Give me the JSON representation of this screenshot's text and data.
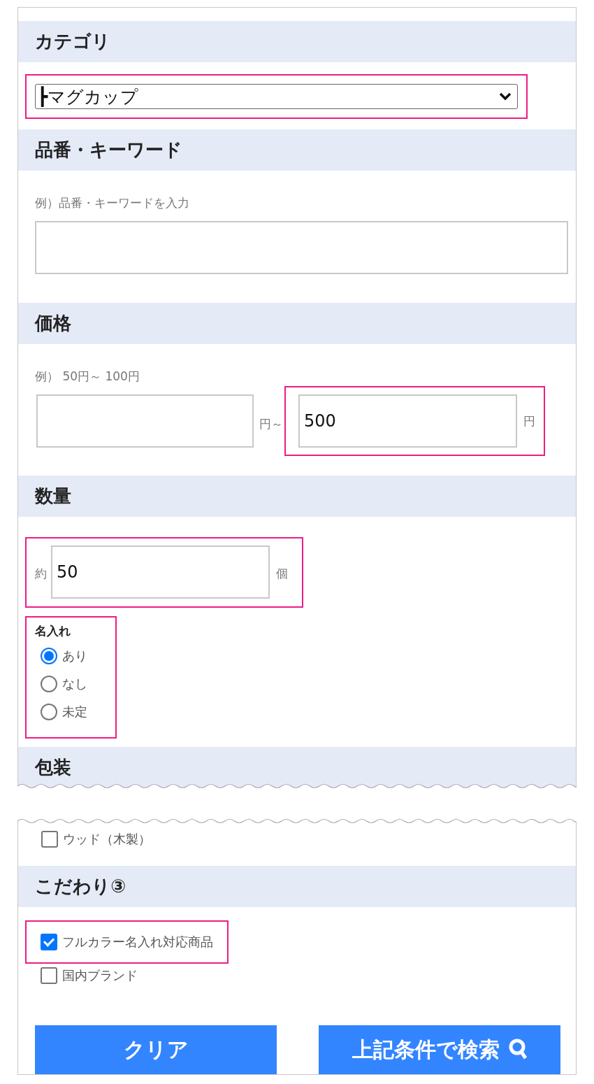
{
  "category": {
    "heading": "カテゴリ",
    "select": {
      "value": "┣マグカップ",
      "highlighted": true
    }
  },
  "keyword": {
    "heading": "品番・キーワード",
    "hint": "例）品番・キーワードを入力"
  },
  "price": {
    "heading": "価格",
    "hint": "例） 50円～ 100円",
    "min": {
      "highlighted": false
    },
    "range_sign": "円～",
    "max": {
      "value": "500",
      "unit": "円",
      "highlighted": true
    }
  },
  "quantity": {
    "heading": "数量",
    "prefix": "約",
    "value": "50",
    "unit": "個",
    "highlighted": true
  },
  "name_entry": {
    "label": "名入れ",
    "highlighted": true,
    "options": [
      {
        "label": "あり",
        "selected": true
      },
      {
        "label": "なし",
        "selected": false
      },
      {
        "label": "未定",
        "selected": false
      }
    ]
  },
  "packaging": {
    "heading": "包装",
    "options": [
      {
        "label": "ウッド（木製）",
        "checked": false
      }
    ]
  },
  "preferences": {
    "heading": "こだわり③",
    "options": [
      {
        "label": "フルカラー名入れ対応商品",
        "checked": true,
        "highlighted": true
      },
      {
        "label": "国内ブランド",
        "checked": false,
        "highlighted": false
      }
    ]
  },
  "buttons": [
    {
      "label": "クリア",
      "kind": "clear"
    },
    {
      "label": "上記条件で検索",
      "kind": "search"
    }
  ]
}
